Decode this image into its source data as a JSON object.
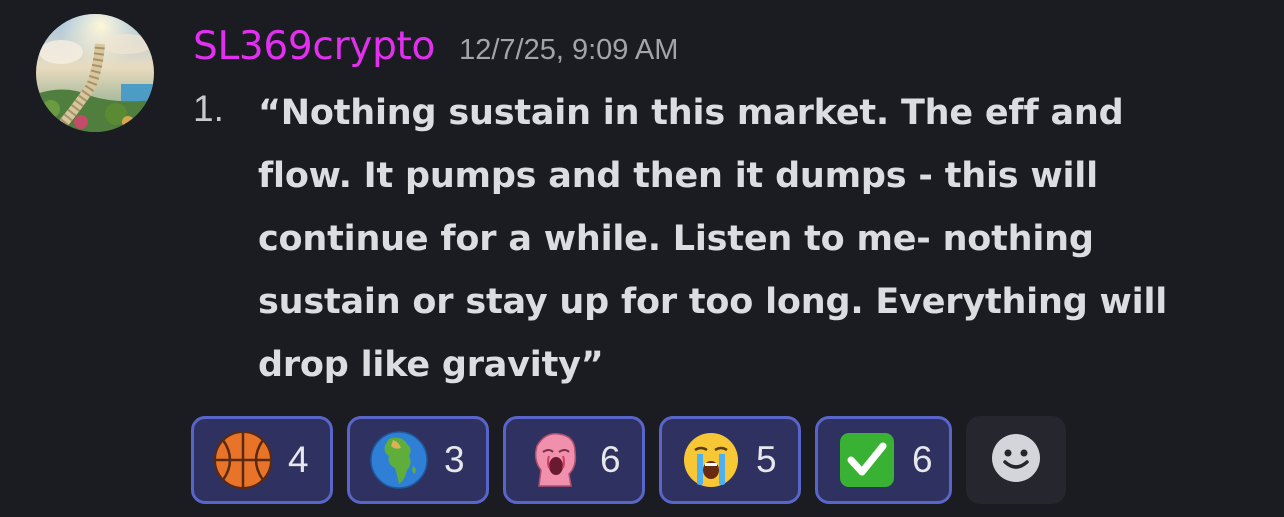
{
  "message": {
    "username": "SL369crypto",
    "timestamp": "12/7/25, 9:09 AM",
    "list_marker": "1.",
    "lines": [
      "“Nothing sustain in this market. The eff and",
      "flow. It pumps and then it dumps - this will",
      "continue for a while. Listen to me- nothing",
      "sustain or stay up for too long. Everything will",
      "drop like gravity”"
    ]
  },
  "reactions": [
    {
      "emoji": "basketball-icon",
      "count": "4"
    },
    {
      "emoji": "globe-africa-icon",
      "count": "3"
    },
    {
      "emoji": "pink-wojak-screaming-icon",
      "count": "6"
    },
    {
      "emoji": "crying-face-icon",
      "count": "5"
    },
    {
      "emoji": "check-mark-button-icon",
      "count": "6"
    }
  ],
  "add_reaction": {
    "icon": "smiley-add-reaction-icon"
  },
  "colors": {
    "background": "#1b1b22",
    "username": "#e22ff0",
    "reaction_border": "#5965c8",
    "reaction_fill": "#2f3260"
  }
}
